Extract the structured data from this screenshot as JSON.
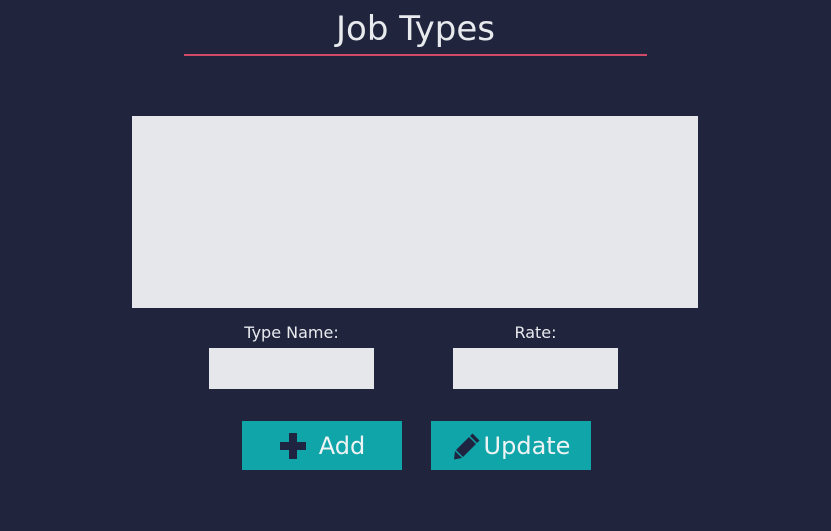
{
  "header": {
    "title": "Job Types"
  },
  "list": {
    "items": []
  },
  "form": {
    "type_name_label": "Type Name:",
    "type_name_value": "",
    "rate_label": "Rate:",
    "rate_value": ""
  },
  "actions": {
    "add_label": "Add",
    "add_icon": "plus-icon",
    "update_label": "Update",
    "update_icon": "pencil-icon"
  },
  "colors": {
    "background": "#20253d",
    "accent_underline": "#d04a68",
    "button": "#10a5a9",
    "field": "#e6e7ea"
  }
}
